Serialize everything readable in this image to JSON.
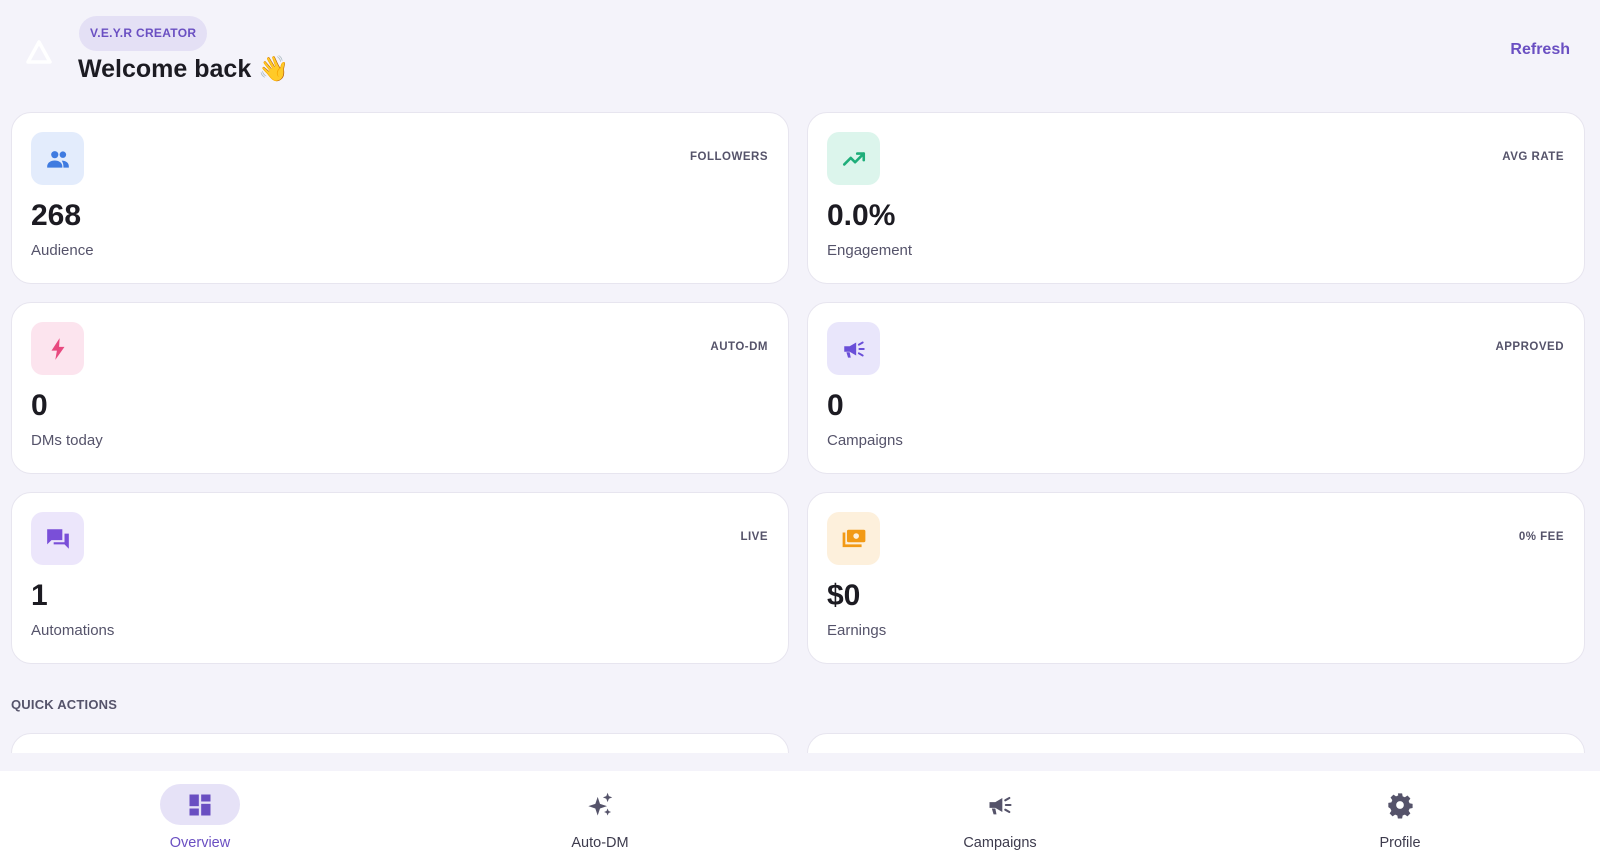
{
  "header": {
    "badge": "V.E.Y.R CREATOR",
    "welcome": "Welcome back 👋",
    "refresh_label": "Refresh"
  },
  "stats": [
    {
      "tag": "FOLLOWERS",
      "value": "268",
      "label": "Audience",
      "icon": "people-icon",
      "icon_bg": "#e3ecfc",
      "icon_color": "#3f7be0"
    },
    {
      "tag": "AVG RATE",
      "value": "0.0%",
      "label": "Engagement",
      "icon": "trending-up-icon",
      "icon_bg": "#dcf5ec",
      "icon_color": "#1fae7a"
    },
    {
      "tag": "AUTO-DM",
      "value": "0",
      "label": "DMs today",
      "icon": "lightning-icon",
      "icon_bg": "#fce4ee",
      "icon_color": "#e8497f"
    },
    {
      "tag": "APPROVED",
      "value": "0",
      "label": "Campaigns",
      "icon": "megaphone-icon",
      "icon_bg": "#e9e6fb",
      "icon_color": "#6a4fd8"
    },
    {
      "tag": "LIVE",
      "value": "1",
      "label": "Automations",
      "icon": "chat-icon",
      "icon_bg": "#ece6fb",
      "icon_color": "#7a4fd8"
    },
    {
      "tag": "0% FEE",
      "value": "$0",
      "label": "Earnings",
      "icon": "money-icon",
      "icon_bg": "#fdf0dc",
      "icon_color": "#f29a16"
    }
  ],
  "quick_actions": {
    "title": "QUICK ACTIONS"
  },
  "nav": {
    "items": [
      {
        "label": "Overview",
        "icon": "dashboard-icon",
        "active": true
      },
      {
        "label": "Auto-DM",
        "icon": "sparkles-icon",
        "active": false
      },
      {
        "label": "Campaigns",
        "icon": "megaphone-icon",
        "active": false
      },
      {
        "label": "Profile",
        "icon": "gear-icon",
        "active": false
      }
    ]
  },
  "colors": {
    "accent": "#6a4fc2",
    "background": "#f4f3fa"
  }
}
